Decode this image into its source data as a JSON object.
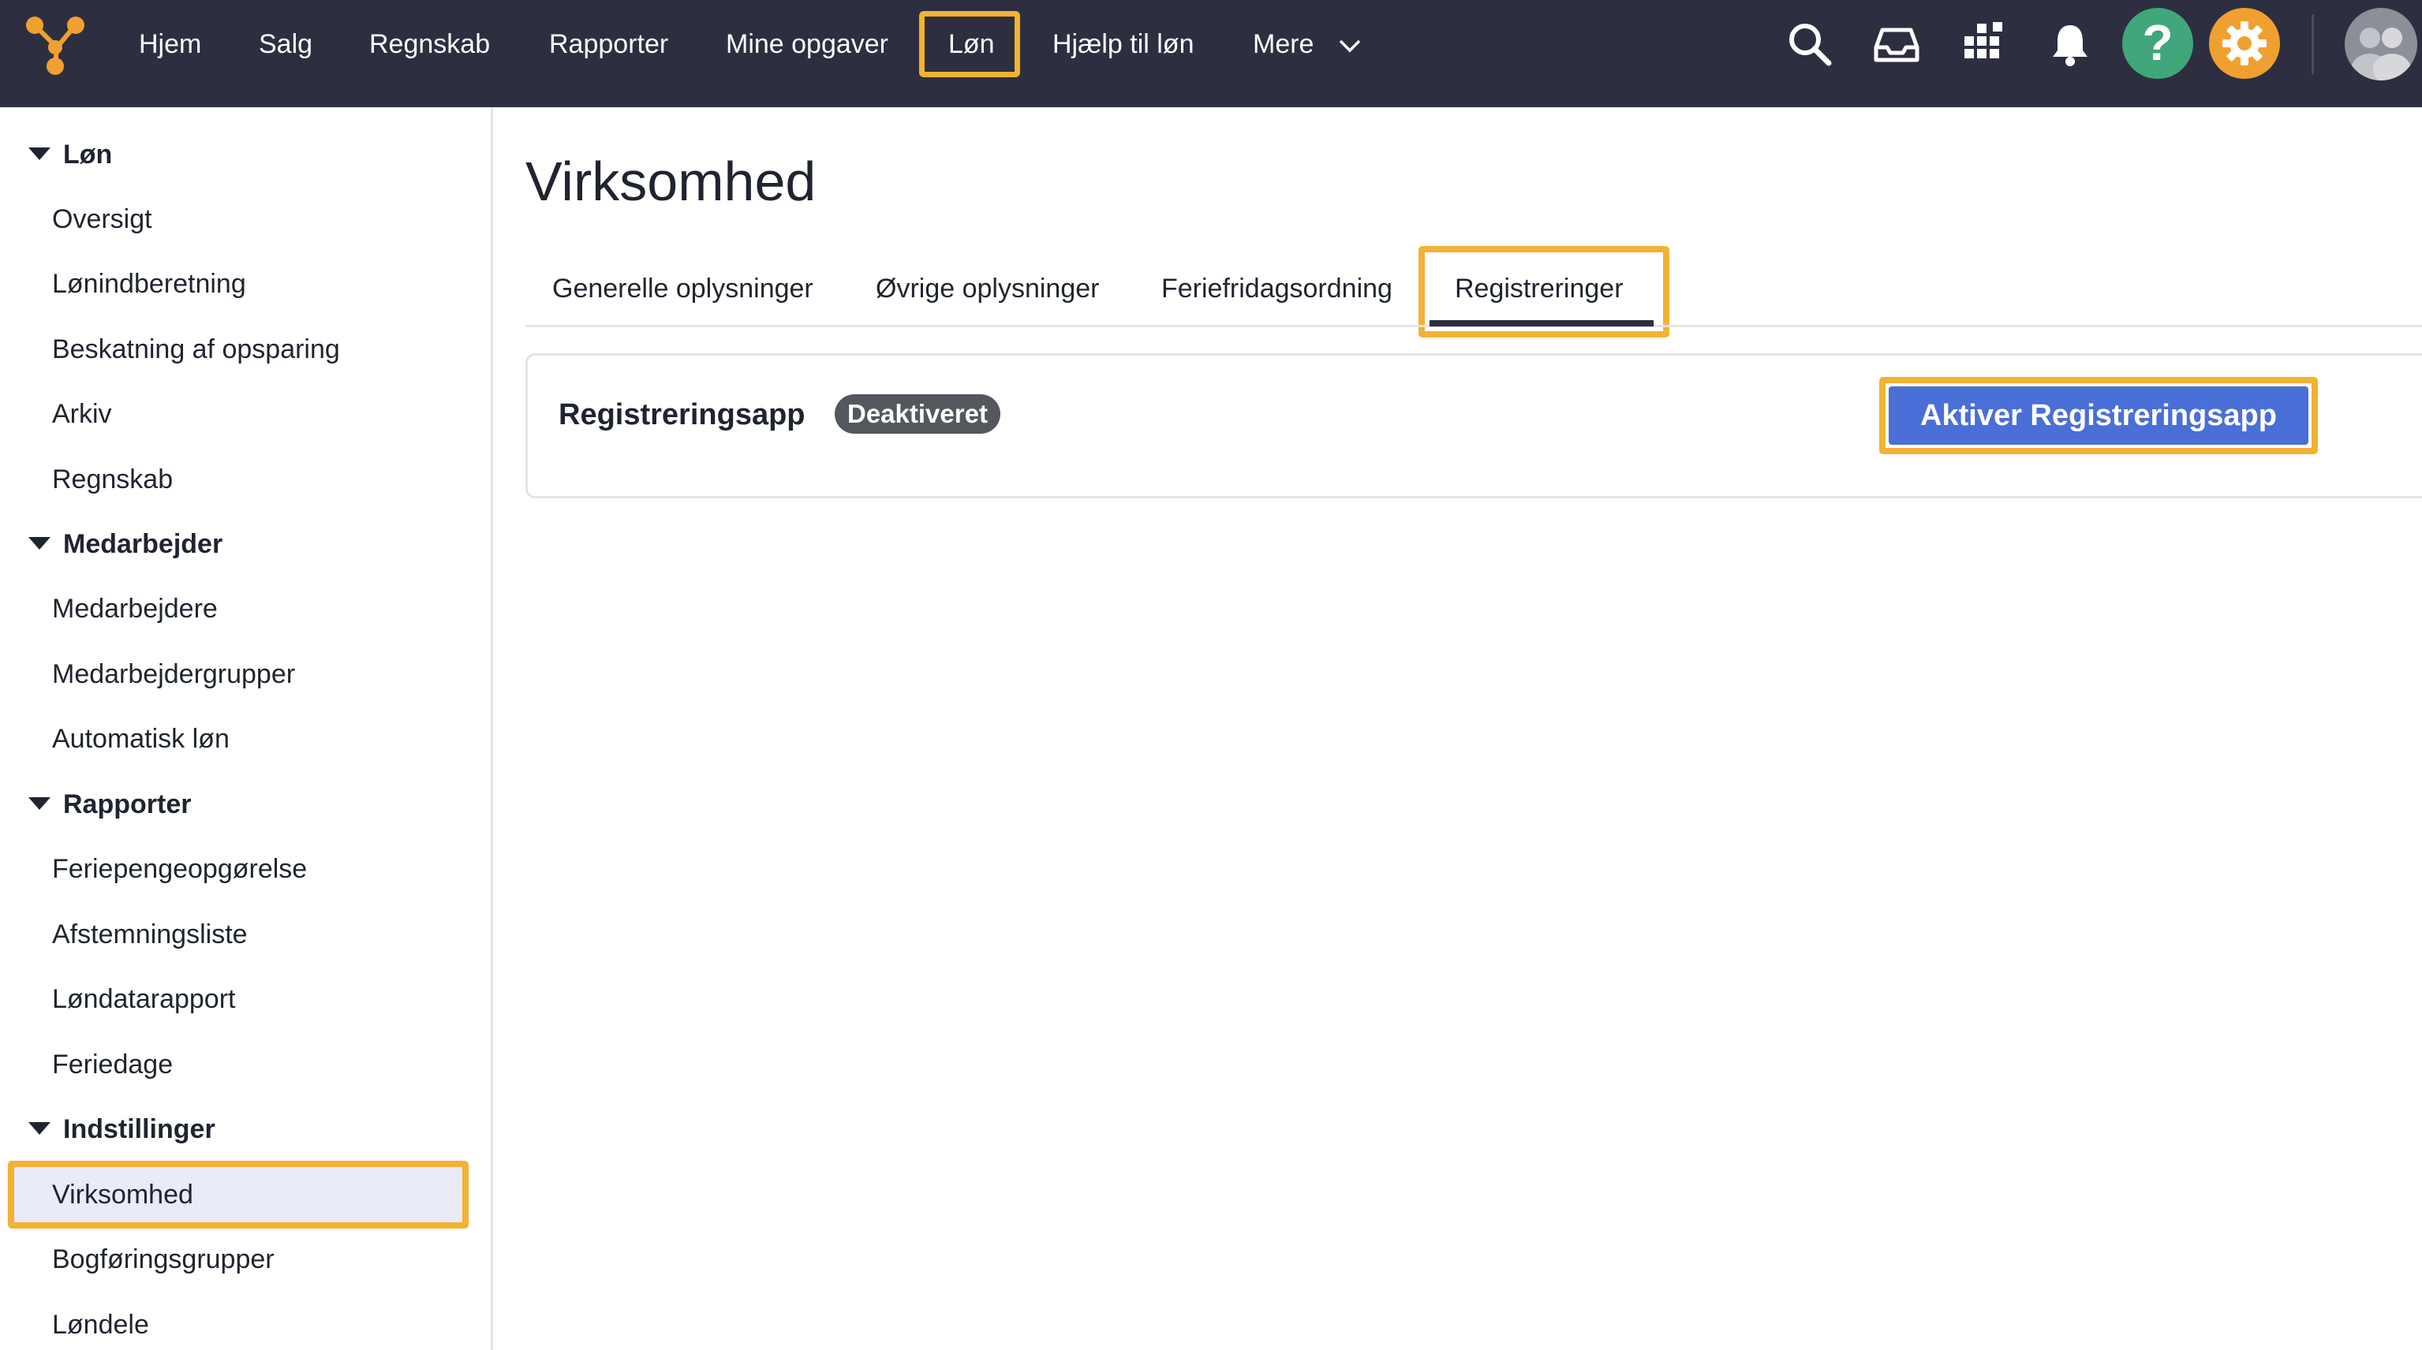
{
  "topnav": {
    "items": [
      "Hjem",
      "Salg",
      "Regnskab",
      "Rapporter",
      "Mine opgaver",
      "Løn",
      "Hjælp til løn",
      "Mere"
    ],
    "active_item": "Løn",
    "icons": [
      "search-icon",
      "inbox-icon",
      "apps-grid-icon",
      "bell-icon",
      "help-icon",
      "gear-icon",
      "avatar-icon"
    ],
    "colors": {
      "bar": "#2d2f40",
      "help": "#3fa77a",
      "settings": "#f0a030",
      "logo": "#f0a030",
      "highlight": "#f2b233"
    }
  },
  "sidebar": {
    "sections": [
      {
        "title": "Løn",
        "items": [
          "Oversigt",
          "Lønindberetning",
          "Beskatning af opsparing",
          "Arkiv",
          "Regnskab"
        ]
      },
      {
        "title": "Medarbejder",
        "items": [
          "Medarbejdere",
          "Medarbejdergrupper",
          "Automatisk løn"
        ]
      },
      {
        "title": "Rapporter",
        "items": [
          "Feriepengeopgørelse",
          "Afstemningsliste",
          "Løndatarapport",
          "Feriedage"
        ]
      },
      {
        "title": "Indstillinger",
        "items": [
          "Virksomhed",
          "Bogføringsgrupper",
          "Løndele"
        ]
      }
    ],
    "active_item": "Virksomhed"
  },
  "main": {
    "title": "Virksomhed",
    "tabs": [
      "Generelle oplysninger",
      "Øvrige oplysninger",
      "Feriefridagsordning",
      "Registreringer"
    ],
    "active_tab": "Registreringer",
    "card": {
      "title": "Registreringsapp",
      "status_badge": "Deaktiveret",
      "action_button": "Aktiver Registreringsapp"
    },
    "colors": {
      "primary_button": "#4a6fd6",
      "badge": "#55575e"
    }
  }
}
